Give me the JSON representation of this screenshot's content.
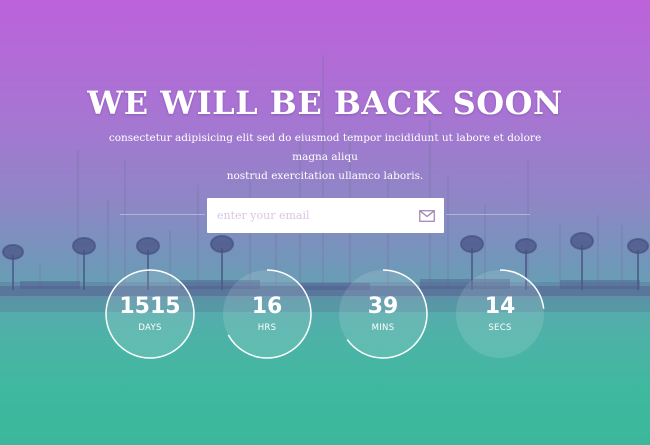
{
  "heading": "WE WILL BE BACK SOON",
  "subtitle_line1": "consectetur adipisicing elit sed do eiusmod tempor incididunt ut labore et dolore magna aliqu",
  "subtitle_line2": "nostrud exercitation ullamco laboris.",
  "email": {
    "placeholder": "enter your email",
    "value": "",
    "icon": "envelope-icon"
  },
  "countdown": [
    {
      "value": "1515",
      "label": "DAYS",
      "progress": 1.0
    },
    {
      "value": "16",
      "label": "HRS",
      "progress": 0.67
    },
    {
      "value": "39",
      "label": "MINS",
      "progress": 0.65
    },
    {
      "value": "14",
      "label": "SECS",
      "progress": 0.23
    }
  ],
  "colors": {
    "gradient_top": "#bd62db",
    "gradient_bottom": "#3cb79b",
    "text": "#ffffff",
    "placeholder": "#d9c6e6"
  }
}
